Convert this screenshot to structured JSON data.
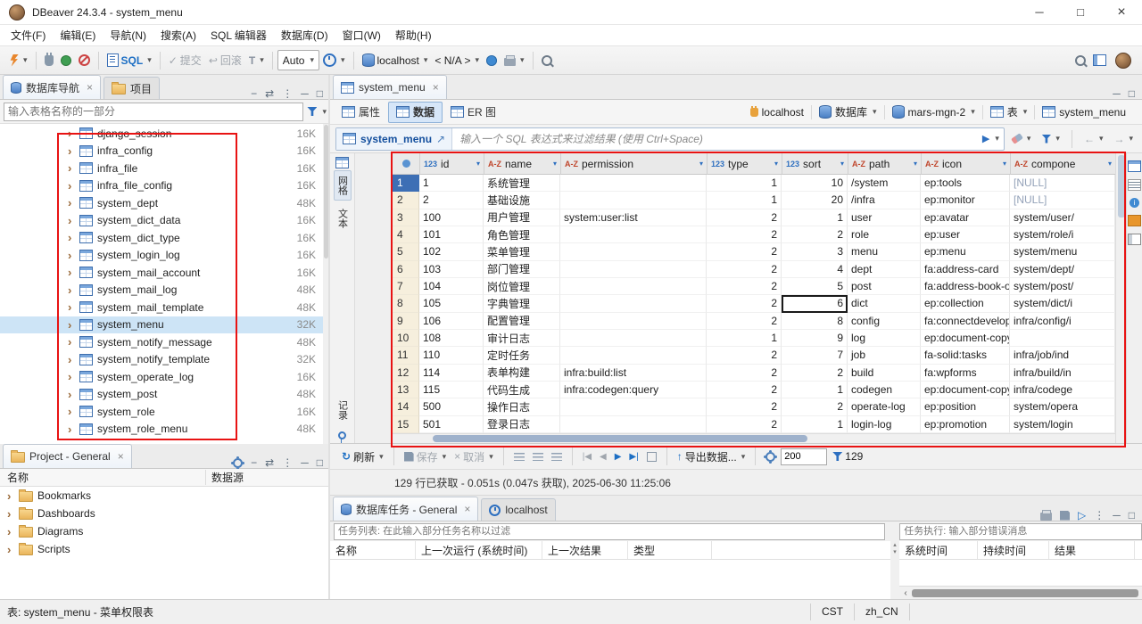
{
  "window": {
    "title": "DBeaver 24.3.4 - system_menu"
  },
  "icons": {
    "close": "×",
    "caret": "▾",
    "chevron": "›",
    "play": "▶",
    "play_outline": "▷",
    "refresh": "↻",
    "up_arrow": "↑",
    "left": "◀",
    "right": "▶",
    "first": "|◀",
    "last": "▶|",
    "minimize": "─",
    "maximize": "□",
    "link": "⇄",
    "dots": "⋮",
    "collapse": "−",
    "expand": "↗",
    "back": "←",
    "forward": "→",
    "check": "✓",
    "rollback": "↩",
    "tx": "T",
    "up_small": "▴",
    "down_small": "▾",
    "left_small": "‹"
  },
  "menu": {
    "items": [
      "文件(F)",
      "编辑(E)",
      "导航(N)",
      "搜索(A)",
      "SQL 编辑器",
      "数据库(D)",
      "窗口(W)",
      "帮助(H)"
    ]
  },
  "toolbar": {
    "sql": "SQL",
    "commit": "提交",
    "rollback": "回滚",
    "tx_mode": "Auto",
    "connection": "localhost",
    "schema": "< N/A >"
  },
  "navigator": {
    "tab_database": "数据库导航",
    "tab_project": "项目",
    "filter_placeholder": "输入表格名称的一部分",
    "selected_table": "system_menu",
    "tables": [
      {
        "name": "django_session",
        "size": "16K"
      },
      {
        "name": "infra_config",
        "size": "16K"
      },
      {
        "name": "infra_file",
        "size": "16K"
      },
      {
        "name": "infra_file_config",
        "size": "16K"
      },
      {
        "name": "system_dept",
        "size": "48K"
      },
      {
        "name": "system_dict_data",
        "size": "16K"
      },
      {
        "name": "system_dict_type",
        "size": "16K"
      },
      {
        "name": "system_login_log",
        "size": "16K"
      },
      {
        "name": "system_mail_account",
        "size": "16K"
      },
      {
        "name": "system_mail_log",
        "size": "48K"
      },
      {
        "name": "system_mail_template",
        "size": "48K"
      },
      {
        "name": "system_menu",
        "size": "32K"
      },
      {
        "name": "system_notify_message",
        "size": "48K"
      },
      {
        "name": "system_notify_template",
        "size": "32K"
      },
      {
        "name": "system_operate_log",
        "size": "16K"
      },
      {
        "name": "system_post",
        "size": "48K"
      },
      {
        "name": "system_role",
        "size": "16K"
      },
      {
        "name": "system_role_menu",
        "size": "48K"
      }
    ]
  },
  "project": {
    "tab": "Project - General",
    "col_name": "名称",
    "col_source": "数据源",
    "items": [
      "Bookmarks",
      "Dashboards",
      "Diagrams",
      "Scripts"
    ]
  },
  "editor": {
    "tab": "system_menu",
    "subtab_properties": "属性",
    "subtab_data": "数据",
    "subtab_er": "ER 图",
    "breadcrumb": [
      {
        "label": "localhost"
      },
      {
        "label": "数据库"
      },
      {
        "label": "mars-mgn-2"
      },
      {
        "label": "表"
      },
      {
        "label": "system_menu"
      }
    ],
    "filter_table": "system_menu",
    "filter_placeholder": "输入一个 SQL 表达式来过滤结果 (使用 Ctrl+Space)",
    "side_tab_grid": "网格",
    "side_tab_text": "文本",
    "side_tab_record": "记录"
  },
  "grid": {
    "columns": [
      {
        "badge": "123",
        "label": "id"
      },
      {
        "badge": "A-Z",
        "label": "name"
      },
      {
        "badge": "A-Z",
        "label": "permission"
      },
      {
        "badge": "123",
        "label": "type"
      },
      {
        "badge": "123",
        "label": "sort"
      },
      {
        "badge": "A-Z",
        "label": "path"
      },
      {
        "badge": "A-Z",
        "label": "icon"
      },
      {
        "badge": "A-Z",
        "label": "compone"
      }
    ],
    "rows": [
      [
        "1",
        "系统管理",
        "",
        "1",
        "10",
        "/system",
        "ep:tools",
        "[NULL]"
      ],
      [
        "2",
        "基础设施",
        "",
        "1",
        "20",
        "/infra",
        "ep:monitor",
        "[NULL]"
      ],
      [
        "100",
        "用户管理",
        "system:user:list",
        "2",
        "1",
        "user",
        "ep:avatar",
        "system/user/"
      ],
      [
        "101",
        "角色管理",
        "",
        "2",
        "2",
        "role",
        "ep:user",
        "system/role/i"
      ],
      [
        "102",
        "菜单管理",
        "",
        "2",
        "3",
        "menu",
        "ep:menu",
        "system/menu"
      ],
      [
        "103",
        "部门管理",
        "",
        "2",
        "4",
        "dept",
        "fa:address-card",
        "system/dept/"
      ],
      [
        "104",
        "岗位管理",
        "",
        "2",
        "5",
        "post",
        "fa:address-book-o",
        "system/post/"
      ],
      [
        "105",
        "字典管理",
        "",
        "2",
        "6",
        "dict",
        "ep:collection",
        "system/dict/i"
      ],
      [
        "106",
        "配置管理",
        "",
        "2",
        "8",
        "config",
        "fa:connectdevelop",
        "infra/config/i"
      ],
      [
        "108",
        "审计日志",
        "",
        "1",
        "9",
        "log",
        "ep:document-copy",
        ""
      ],
      [
        "110",
        "定时任务",
        "",
        "2",
        "7",
        "job",
        "fa-solid:tasks",
        "infra/job/ind"
      ],
      [
        "114",
        "表单构建",
        "infra:build:list",
        "2",
        "2",
        "build",
        "fa:wpforms",
        "infra/build/in"
      ],
      [
        "115",
        "代码生成",
        "infra:codegen:query",
        "2",
        "1",
        "codegen",
        "ep:document-copy",
        "infra/codege"
      ],
      [
        "500",
        "操作日志",
        "",
        "2",
        "2",
        "operate-log",
        "ep:position",
        "system/opera"
      ],
      [
        "501",
        "登录日志",
        "",
        "2",
        "1",
        "login-log",
        "ep:promotion",
        "system/login"
      ]
    ]
  },
  "result_toolbar": {
    "refresh": "刷新",
    "save": "保存",
    "cancel": "取消",
    "export": "导出数据...",
    "fetch_size": "200",
    "filter_count": "129"
  },
  "status_line": {
    "text": "129 行已获取 - 0.051s (0.047s 获取), 2025-06-30 11:25:06"
  },
  "tasks": {
    "tab_tasks": "数据库任务 - General",
    "tab_localhost": "localhost",
    "filter_placeholder": "任务列表: 在此输入部分任务名称以过滤",
    "columns": [
      "名称",
      "上一次运行 (系统时间)",
      "上一次结果",
      "类型"
    ],
    "exec_filter_placeholder": "任务执行: 输入部分错误消息",
    "exec_columns": [
      "系统时间",
      "持续时间",
      "结果"
    ]
  },
  "statusbar": {
    "left": "表: system_menu - 菜单权限表",
    "timezone": "CST",
    "locale": "zh_CN"
  }
}
